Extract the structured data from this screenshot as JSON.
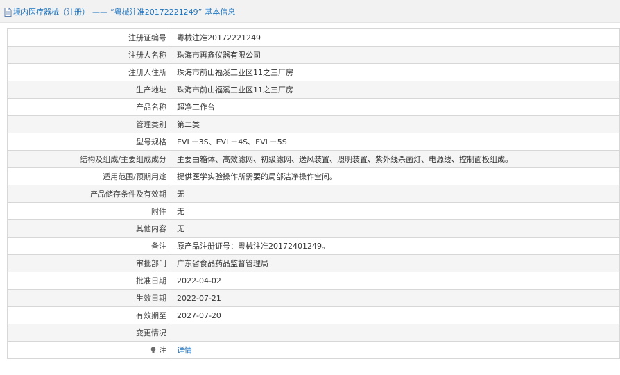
{
  "header": {
    "crumb_link": "境内医疗器械（注册）",
    "separator": "——",
    "record_title": "“粤械注准20172221249”",
    "suffix": "基本信息"
  },
  "rows": [
    {
      "label": "注册证编号",
      "value": "粤械注准20172221249"
    },
    {
      "label": "注册人名称",
      "value": "珠海市再鑫仪器有限公司"
    },
    {
      "label": "注册人住所",
      "value": "珠海市前山福溪工业区11之三厂房"
    },
    {
      "label": "生产地址",
      "value": "珠海市前山福溪工业区11之三厂房"
    },
    {
      "label": "产品名称",
      "value": "超净工作台"
    },
    {
      "label": "管理类别",
      "value": "第二类"
    },
    {
      "label": "型号规格",
      "value": "EVL－3S、EVL－4S、EVL－5S"
    },
    {
      "label": "结构及组成/主要组成成分",
      "value": "主要由箱体、高效滤网、初级滤网、送风装置、照明装置、紫外线杀菌灯、电源线、控制面板组成。"
    },
    {
      "label": "适用范围/预期用途",
      "value": "提供医学实验操作所需要的局部洁净操作空间。"
    },
    {
      "label": "产品储存条件及有效期",
      "value": "无"
    },
    {
      "label": "附件",
      "value": "无"
    },
    {
      "label": "其他内容",
      "value": "无"
    },
    {
      "label": "备注",
      "value": "原产品注册证号：粤械注准20172401249。"
    },
    {
      "label": "审批部门",
      "value": "广东省食品药品监督管理局"
    },
    {
      "label": "批准日期",
      "value": "2022-04-02"
    },
    {
      "label": "生效日期",
      "value": "2022-07-21"
    },
    {
      "label": "有效期至",
      "value": "2027-07-20"
    },
    {
      "label": "变更情况",
      "value": ""
    }
  ],
  "note_row": {
    "label": "注",
    "icon": "bulb-icon",
    "link_text": "详情"
  },
  "colors": {
    "link": "#1a73c0",
    "row_alt": "#f5f5f5",
    "border": "#d7d7d7",
    "header_bg": "#f2f2f2"
  }
}
